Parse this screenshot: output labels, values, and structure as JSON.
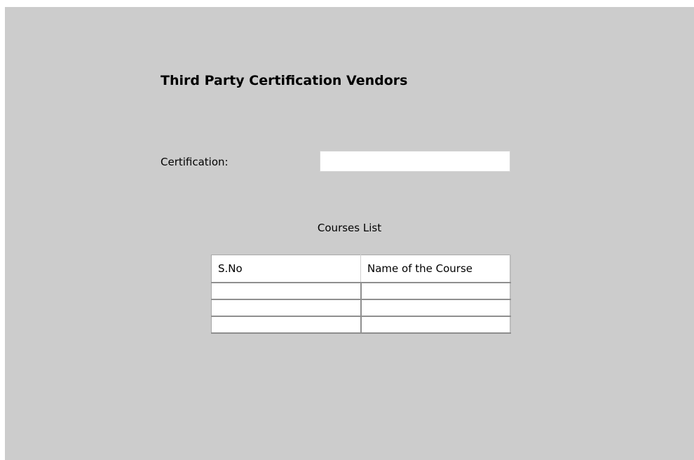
{
  "page": {
    "title": "Third Party Certification Vendors"
  },
  "form": {
    "certification_label": "Certification:",
    "certification_value": ""
  },
  "courses": {
    "heading": "Courses List",
    "columns": [
      "S.No",
      "Name of the Course"
    ],
    "rows": [
      [
        "",
        ""
      ],
      [
        "",
        ""
      ],
      [
        "",
        ""
      ]
    ]
  },
  "colors": {
    "background": "#cccccc",
    "table_background": "#ffffff",
    "grid_line": "#8f8f8f"
  }
}
